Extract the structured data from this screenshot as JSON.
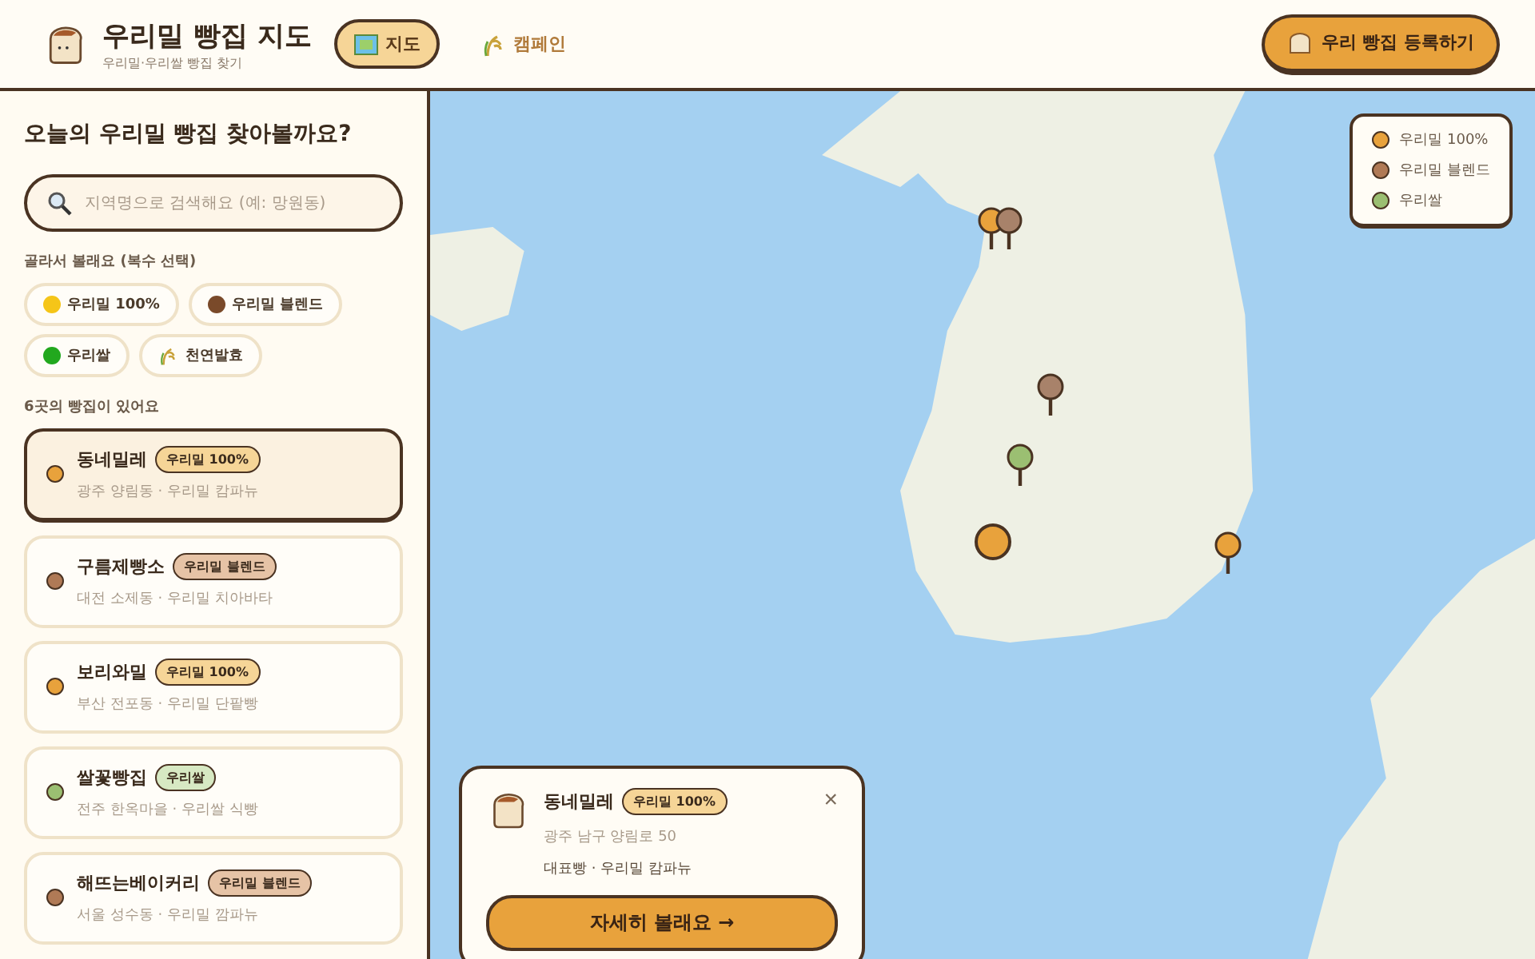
{
  "header": {
    "title": "우리밀 빵집 지도",
    "subtitle": "우리밀·우리쌀 빵집 찾기",
    "nav": [
      {
        "label": "지도",
        "selected": true
      },
      {
        "label": "캠페인",
        "selected": false
      }
    ],
    "register_button": "우리 빵집 등록하기"
  },
  "sidebar": {
    "heading": "오늘의 우리밀 빵집 찾아볼까요?",
    "search": {
      "placeholder": "지역명으로 검색해요 (예: 망원동)"
    },
    "filter_label": "골라서 볼래요 (복수 선택)",
    "filters": [
      {
        "label": "우리밀 100%",
        "kind": "dot",
        "color": "#f5c518",
        "selected": false
      },
      {
        "label": "우리밀 블렌드",
        "kind": "dot",
        "color": "#7a4a2a",
        "selected": false
      },
      {
        "label": "우리쌀",
        "kind": "dot",
        "color": "#22a81e",
        "selected": false
      },
      {
        "label": "천연발효",
        "kind": "wheat",
        "selected": false
      }
    ],
    "count": "6곳의 빵집이 있어요",
    "shops": [
      {
        "name": "동네밀레",
        "badge": "우리밀 100%",
        "detail": "광주 양림동 · 우리밀 캄파뉴",
        "color": "#e8a23c",
        "selected": true
      },
      {
        "name": "구름제빵소",
        "badge": "우리밀 블렌드",
        "detail": "대전 소제동 · 우리밀 치아바타",
        "color": "#b07a56",
        "selected": false
      },
      {
        "name": "보리와밀",
        "badge": "우리밀 100%",
        "detail": "부산 전포동 · 우리밀 단팥빵",
        "color": "#e8a23c",
        "selected": false
      },
      {
        "name": "쌀꽃빵집",
        "badge": "우리쌀",
        "detail": "전주 한옥마을 · 우리쌀 식빵",
        "color": "#9bbf72",
        "selected": false
      },
      {
        "name": "해뜨는베이커리",
        "badge": "우리밀 블렌드",
        "detail": "서울 성수동 · 우리밀 깜파뉴",
        "color": "#b07a56",
        "selected": false
      }
    ]
  },
  "map": {
    "legend": [
      {
        "label": "우리밀 100%",
        "color": "#e8a23c"
      },
      {
        "label": "우리밀 블렌드",
        "color": "#b07a56"
      },
      {
        "label": "우리쌀",
        "color": "#9bbf72"
      }
    ],
    "pins": [
      {
        "color": "#e8a23c",
        "selected": false
      },
      {
        "color": "#a8826a",
        "selected": false
      },
      {
        "color": "#a8826a",
        "selected": false
      },
      {
        "color": "#9bbf72",
        "selected": false
      },
      {
        "color": "#e8a23c",
        "selected": true
      },
      {
        "color": "#e8a23c",
        "selected": false
      }
    ],
    "popup": {
      "name": "동네밀레",
      "badge": "우리밀 100%",
      "address": "광주 남구 양림로 50",
      "signature": "대표빵 · 우리밀 캄파뉴",
      "close": "×",
      "button": "자세히 볼래요 →"
    }
  }
}
